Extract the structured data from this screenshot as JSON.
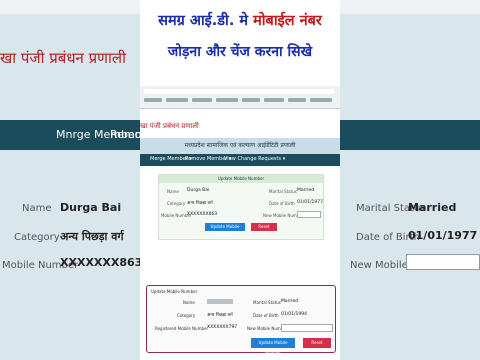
{
  "banner": {
    "line1_blue": "समग्र आई.डी. मे",
    "line1_red": "मोबाईल नंबर",
    "line2": "जोड़ना और चेंज करना सिखे"
  },
  "background": {
    "title_fragment": "खा पंजी प्रबंधन प्रणाली",
    "nav_merge": "Mnrge Member ▾",
    "nav_remove": "Remov",
    "row_name_label": "Name",
    "row_name_value": "Durga Bai",
    "row_category_label": "Category",
    "row_category_value": "अन्य पिछड़ा वर्ग",
    "row_mobile_label": "Mobile Number",
    "row_mobile_value": "XXXXXXX863",
    "right_status_label": "Marital Status",
    "right_status_value": "Married",
    "right_dob_label": "Date of Birth",
    "right_dob_value": "01/01/1977",
    "right_newmob_label": "New Mobile Number"
  },
  "app": {
    "title": "खा पंजी प्रबंधन प्रणाली",
    "subheader": "मध्यप्रदेश सामाजिक एवं कल्याण आईडेंटिटी प्रणाली",
    "nav_items": [
      "Merge Member ▾",
      "Remove Member ▾",
      "View Change Requests ▾"
    ]
  },
  "update_top": {
    "header": "Update Mobile Number",
    "name_label": "Name",
    "name_value": "Durga Bai",
    "category_label": "Category",
    "category_value": "अन्य पिछड़ा वर्ग",
    "mobile_label": "Mobile Number",
    "mobile_value": "XXXXXXX863",
    "status_label": "Marital Status",
    "status_value": "Married",
    "dob_label": "Date of Birth",
    "dob_value": "01/01/1977",
    "newmob_label": "New Mobile Number",
    "update_btn": "Update Mobile Number",
    "reset_btn": "Reset"
  },
  "update_bottom": {
    "header": "Update Mobile Number",
    "name_label": "Name",
    "category_label": "Category",
    "category_value": "अन्य पिछड़ा वर्ग",
    "mobile_label": "Registered Mobile Number",
    "mobile_value": "XXXXXXX797",
    "status_label": "Marital Status",
    "status_value": "Married",
    "dob_label": "Date of Birth",
    "dob_value": "01/01/1994",
    "newmob_label": "New Mobile Number",
    "update_btn": "Update Mobile Number",
    "reset_btn": "Reset"
  },
  "colors": {
    "nav": "#1a4c5b",
    "update_btn": "#1f7fd6",
    "reset_btn": "#d52f4a",
    "accent_border": "#8b2c4b"
  }
}
